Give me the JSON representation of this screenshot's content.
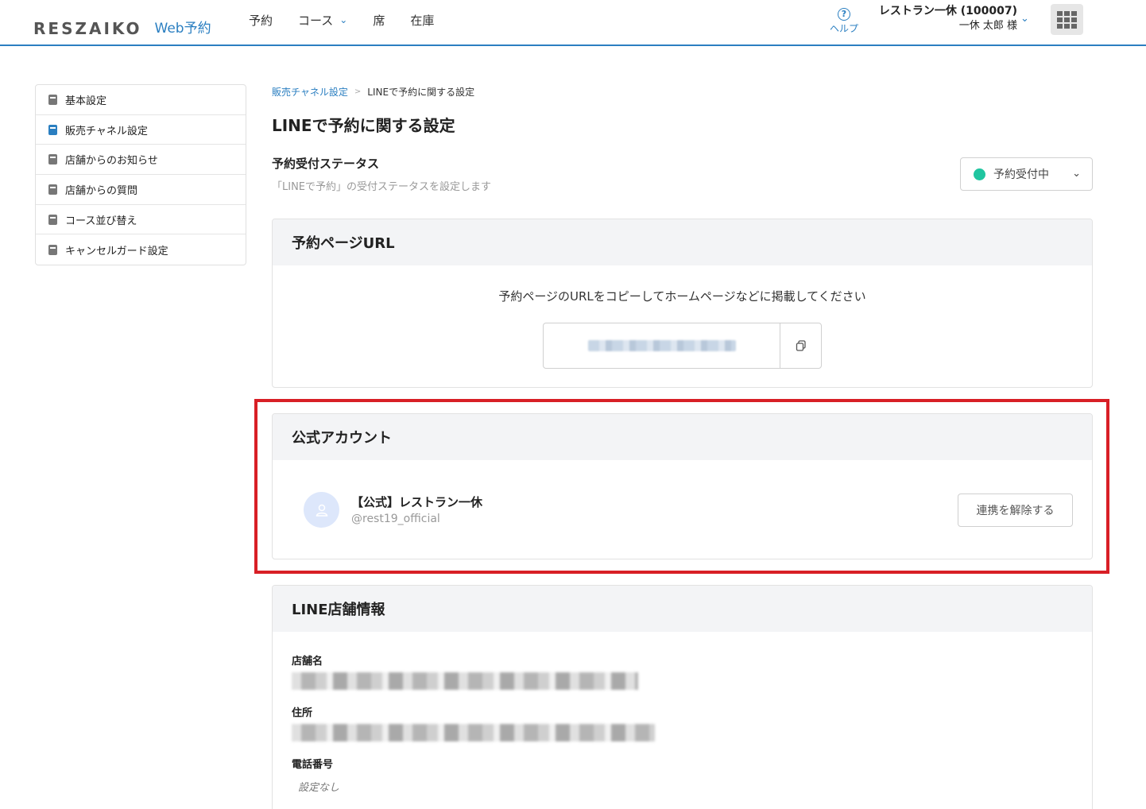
{
  "header": {
    "logo_text": "RESZAIKO",
    "logo_sub": "Web予約",
    "nav": [
      {
        "label": "予約"
      },
      {
        "label": "コース"
      },
      {
        "label": "席"
      },
      {
        "label": "在庫"
      }
    ],
    "help_label": "ヘルプ",
    "account_name": "レストラン一休 (100007)",
    "account_user": "一休 太郎 様"
  },
  "sidebar": {
    "items": [
      {
        "label": "基本設定"
      },
      {
        "label": "販売チャネル設定"
      },
      {
        "label": "店舗からのお知らせ"
      },
      {
        "label": "店舗からの質問"
      },
      {
        "label": "コース並び替え"
      },
      {
        "label": "キャンセルガード設定"
      }
    ]
  },
  "breadcrumb": {
    "parent": "販売チャネル設定",
    "separator": ">",
    "current": "LINEで予約に関する設定"
  },
  "page_title": "LINEで予約に関する設定",
  "status": {
    "title": "予約受付ステータス",
    "description": "「LINEで予約」の受付ステータスを設定します",
    "selected": "予約受付中",
    "dot_color": "#20c5a0"
  },
  "url_section": {
    "title": "予約ページURL",
    "description": "予約ページのURLをコピーしてホームページなどに掲載してください"
  },
  "official_section": {
    "title": "公式アカウント",
    "account_name": "【公式】レストラン一休",
    "account_id": "@rest19_official",
    "unlink_label": "連携を解除する"
  },
  "store_section": {
    "title": "LINE店舗情報",
    "fields": [
      {
        "label": "店舗名"
      },
      {
        "label": "住所"
      },
      {
        "label": "電話番号",
        "value": "設定なし"
      }
    ]
  },
  "colors": {
    "accent": "#2b7fc1",
    "highlight": "#d81f26"
  }
}
